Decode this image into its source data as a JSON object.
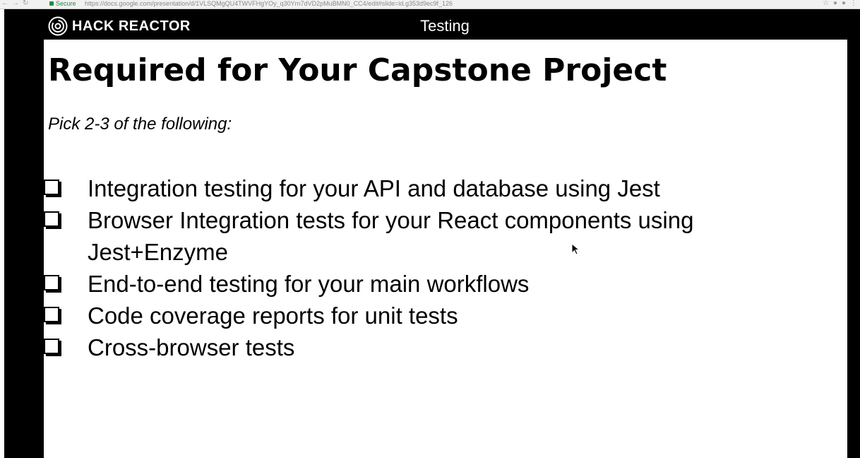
{
  "browser": {
    "secure_label": "Secure",
    "url": "https://docs.google.com/presentation/d/1VLSQMgQU4TWVFHgYOy_q30Yrn7dVD2pMuBMN0_CC4/edit#slide=id.g353d9ec9f_126",
    "nav_icons": [
      "back-icon",
      "forward-icon",
      "reload-icon"
    ]
  },
  "header": {
    "brand": "HACK REACTOR",
    "deck_title": "Testing"
  },
  "slide": {
    "title": "Required for Your Capstone Project",
    "subtitle": "Pick 2-3 of the following:",
    "items": [
      "Integration testing for your API and database using Jest",
      "Browser Integration tests for your React components using Jest+Enzyme",
      "End-to-end testing for your main workflows",
      "Code coverage reports for unit tests",
      "Cross-browser tests"
    ]
  },
  "colors": {
    "frame": "#000000",
    "slide_bg": "#ffffff",
    "secure_green": "#1e8e3e"
  }
}
